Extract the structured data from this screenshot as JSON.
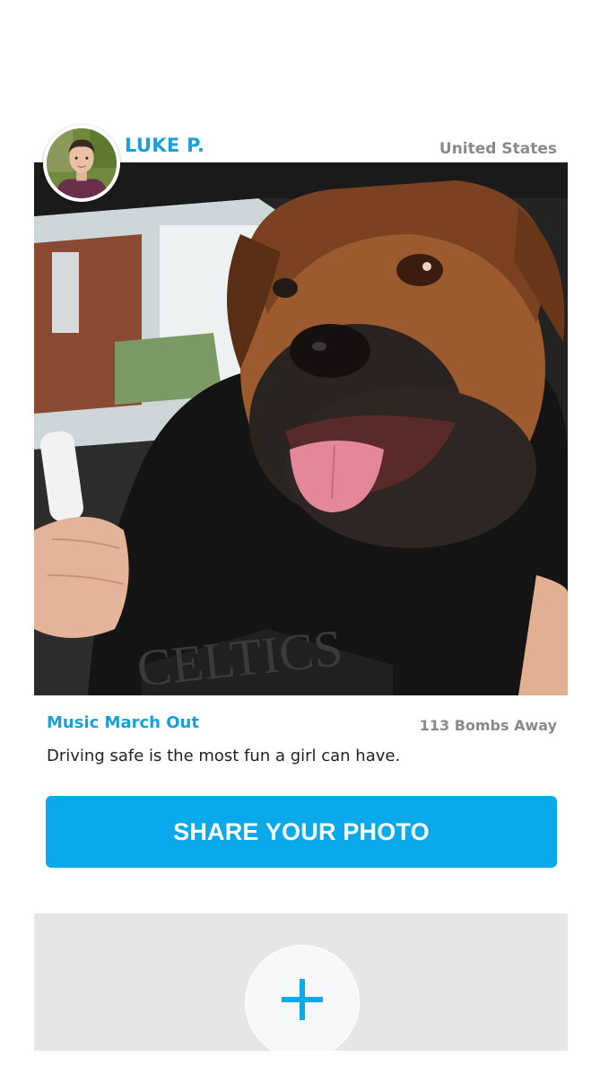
{
  "post": {
    "username": "LUKE P.",
    "location": "United States",
    "avatar_icon": "profile-photo",
    "photo_subject": "dog-driving-photo",
    "title": "Music March Out",
    "count_label": "113 Bombs Away",
    "caption": "Driving safe is the most fun a girl can have.",
    "hoodie_text": "CELTICS"
  },
  "actions": {
    "share_label": "SHARE YOUR PHOTO",
    "add_icon": "plus-icon"
  },
  "colors": {
    "accent": "#0aaaea",
    "link": "#1a9fd8",
    "muted": "#8a8a8a",
    "panel": "#e6e6e6"
  }
}
